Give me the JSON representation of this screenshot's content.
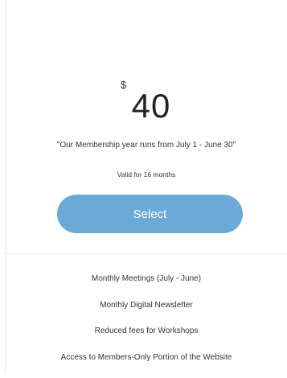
{
  "pricing": {
    "currency_symbol": "$",
    "amount": "40",
    "note": "\"Our Membership year runs from July 1 - June 30\"",
    "validity": "Valid for 16 months",
    "select_label": "Select"
  },
  "features": [
    "Monthly Meetings (July - June)",
    "Monthly Digital Newsletter",
    "Reduced fees for Workshops",
    "Access to Members-Only Portion of the Website"
  ],
  "colors": {
    "accent": "#6baad8",
    "divider": "#e8e8e8"
  }
}
